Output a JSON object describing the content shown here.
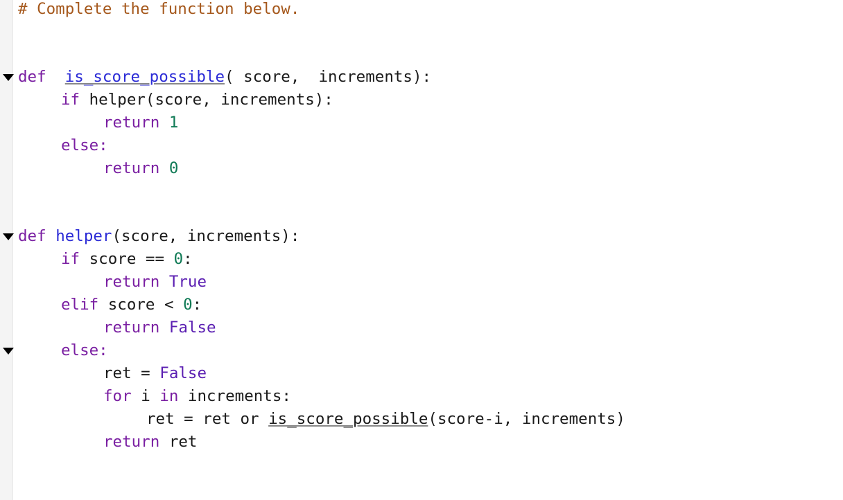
{
  "editor": {
    "comment": "# Complete the function below.",
    "colors": {
      "keyword": "#7a1fa2",
      "function_name": "#2b2bd6",
      "number": "#0f7a55",
      "constant": "#5b1fb2",
      "comment": "#a5581c",
      "text": "#1a1a1a"
    },
    "fold_icons": [
      "triangle-down",
      "triangle-down",
      "triangle-down"
    ]
  },
  "tokens": {
    "def": "def",
    "is_score_possible": "is_score_possible",
    "paren_score_comma": "( score,",
    "increments_close": "increments):",
    "if": "if",
    "helper_call": "helper(score, increments):",
    "return": "return",
    "one": "1",
    "zero": "0",
    "else": "else:",
    "helper": "helper",
    "helper_params": "(score, increments):",
    "score_eq": "score ==",
    "colon": ":",
    "elif": "elif",
    "score_lt": "score <",
    "true": "True",
    "false": "False",
    "ret_assign": "ret =",
    "for": "for",
    "i": "i",
    "in": "in",
    "increments_colon": "increments:",
    "ret_or": "ret = ret or",
    "recursive_call": "is_score_possible",
    "recursive_args": "(score-i, increments)",
    "ret": "ret"
  }
}
